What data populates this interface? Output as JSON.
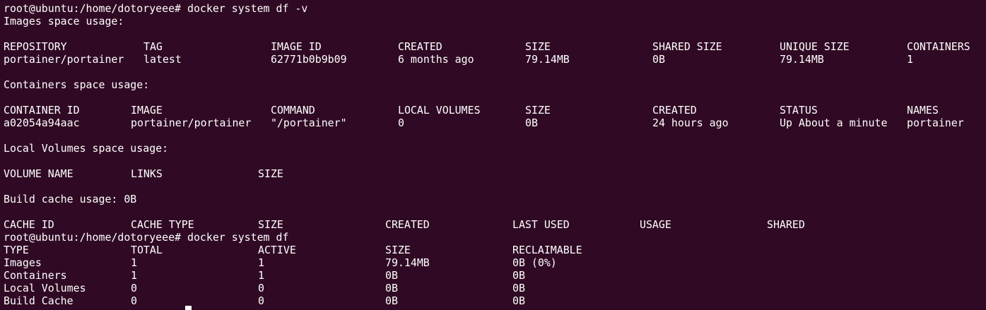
{
  "prompt1": "root@ubuntu:/home/dotoryeee# docker system df -v",
  "images_title": "Images space usage:",
  "images_table": {
    "headers": [
      "REPOSITORY",
      "TAG",
      "IMAGE ID",
      "CREATED",
      "SIZE",
      "SHARED SIZE",
      "UNIQUE SIZE",
      "CONTAINERS"
    ],
    "rows": [
      [
        "portainer/portainer",
        "latest",
        "62771b0b9b09",
        "6 months ago",
        "79.14MB",
        "0B",
        "79.14MB",
        "1"
      ]
    ]
  },
  "containers_title": "Containers space usage:",
  "containers_table": {
    "headers": [
      "CONTAINER ID",
      "IMAGE",
      "COMMAND",
      "LOCAL VOLUMES",
      "SIZE",
      "CREATED",
      "STATUS",
      "NAMES"
    ],
    "rows": [
      [
        "a02054a94aac",
        "portainer/portainer",
        "\"/portainer\"",
        "0",
        "0B",
        "24 hours ago",
        "Up About a minute",
        "portainer"
      ]
    ]
  },
  "volumes_title": "Local Volumes space usage:",
  "volumes_table": {
    "headers": [
      "VOLUME NAME",
      "LINKS",
      "SIZE"
    ]
  },
  "build_cache_title": "Build cache usage: 0B",
  "cache_table": {
    "headers": [
      "CACHE ID",
      "CACHE TYPE",
      "SIZE",
      "CREATED",
      "LAST USED",
      "USAGE",
      "SHARED"
    ]
  },
  "prompt2": "root@ubuntu:/home/dotoryeee# docker system df",
  "df_table": {
    "headers": [
      "TYPE",
      "TOTAL",
      "ACTIVE",
      "SIZE",
      "RECLAIMABLE"
    ],
    "rows": [
      [
        "Images",
        "1",
        "1",
        "79.14MB",
        "0B (0%)"
      ],
      [
        "Containers",
        "1",
        "1",
        "0B",
        "0B"
      ],
      [
        "Local Volumes",
        "0",
        "0",
        "0B",
        "0B"
      ],
      [
        "Build Cache",
        "0",
        "0",
        "0B",
        "0B"
      ]
    ]
  },
  "colors": {
    "background": "#300a24",
    "foreground": "#ffffff"
  }
}
